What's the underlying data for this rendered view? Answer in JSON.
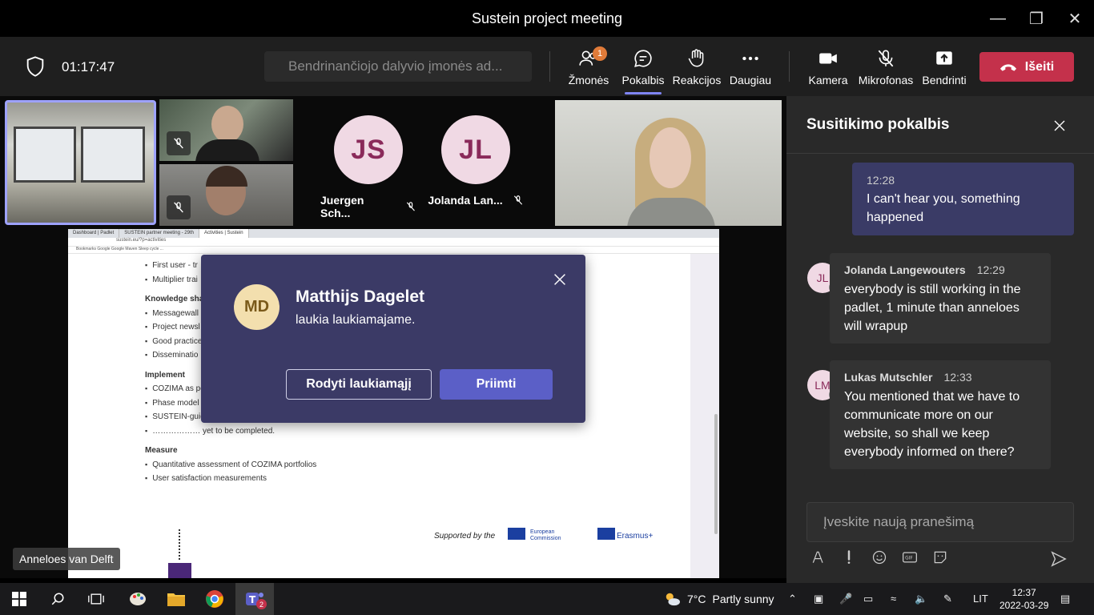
{
  "window": {
    "title": "Sustein project meeting"
  },
  "toolbar": {
    "timer": "01:17:47",
    "share_placeholder": "Bendrinančiojo dalyvio įmonės ad...",
    "people": {
      "label": "Žmonės",
      "badge": "1"
    },
    "chat": {
      "label": "Pokalbis"
    },
    "reactions": {
      "label": "Reakcijos"
    },
    "more": {
      "label": "Daugiau"
    },
    "camera": {
      "label": "Kamera"
    },
    "mic": {
      "label": "Mikrofonas"
    },
    "share": {
      "label": "Bendrinti"
    },
    "leave": {
      "label": "Išeiti"
    }
  },
  "participants": [
    {
      "initials": "JS",
      "name": "Juergen Sch..."
    },
    {
      "initials": "JL",
      "name": "Jolanda Lan..."
    }
  ],
  "shared_screen": {
    "presenter": "Anneloes van Delft",
    "browser_tabs": [
      "Dashboard | Padlet",
      "SUSTEIN partner meeting - 29th",
      "Activities | Sustein"
    ],
    "address": "sustein.eu/?p=activities",
    "bookmarks": "Bookmarks   Google   Google Maven   Sleep cycle   ...",
    "lines": [
      {
        "type": "b",
        "text": "First user - tr"
      },
      {
        "type": "b",
        "text": "Multiplier trai"
      },
      {
        "type": "h",
        "text": "Knowledge shar"
      },
      {
        "type": "b",
        "text": "Messagewall"
      },
      {
        "type": "b",
        "text": "Project newsl"
      },
      {
        "type": "b",
        "text": "Good practice"
      },
      {
        "type": "b",
        "text": "Disseminatio"
      },
      {
        "type": "h",
        "text": "Implement"
      },
      {
        "type": "b",
        "text": "COZIMA as po"
      },
      {
        "type": "b",
        "text": "Phase model"
      },
      {
        "type": "b",
        "text": "SUSTEIN-guid"
      },
      {
        "type": "b",
        "text": "……………… yet to be completed."
      },
      {
        "type": "h",
        "text": "Measure"
      },
      {
        "type": "b",
        "text": "Quantitative assessment of COZIMA portfolios"
      },
      {
        "type": "b",
        "text": "User satisfaction measurements"
      }
    ],
    "supported_by": "Supported by the",
    "ec_line1": "European",
    "ec_line2": "Commission",
    "erasmus": "Erasmus+"
  },
  "lobby_dialog": {
    "initials": "MD",
    "name": "Matthijs Dagelet",
    "message": "laukia laukiamajame.",
    "show_lobby_label": "Rodyti laukiamąjį",
    "admit_label": "Priimti"
  },
  "chat_panel": {
    "title": "Susitikimo pokalbis",
    "messages": [
      {
        "time": "12:28",
        "text": "I can't hear you, something happened"
      },
      {
        "initials": "JL",
        "author": "Jolanda Langewouters",
        "time": "12:29",
        "text": "everybody is still working in the padlet, 1 minute than anneloes will wrapup"
      },
      {
        "initials": "LM",
        "author": "Lukas Mutschler",
        "time": "12:33",
        "text": "You mentioned that we have to communicate more on our website, so shall we keep everybody informed on there?"
      }
    ],
    "compose_placeholder": "Įveskite naują pranešimą"
  },
  "taskbar": {
    "weather_temp": "7°C",
    "weather_desc": "Partly sunny",
    "lang": "LIT",
    "time": "12:37",
    "date": "2022-03-29",
    "teams_badge": "2"
  },
  "colors": {
    "accent": "#5b5fc7",
    "leave": "#c4314b",
    "dialog": "#3b3a66",
    "self_bubble": "#3a3b66"
  }
}
